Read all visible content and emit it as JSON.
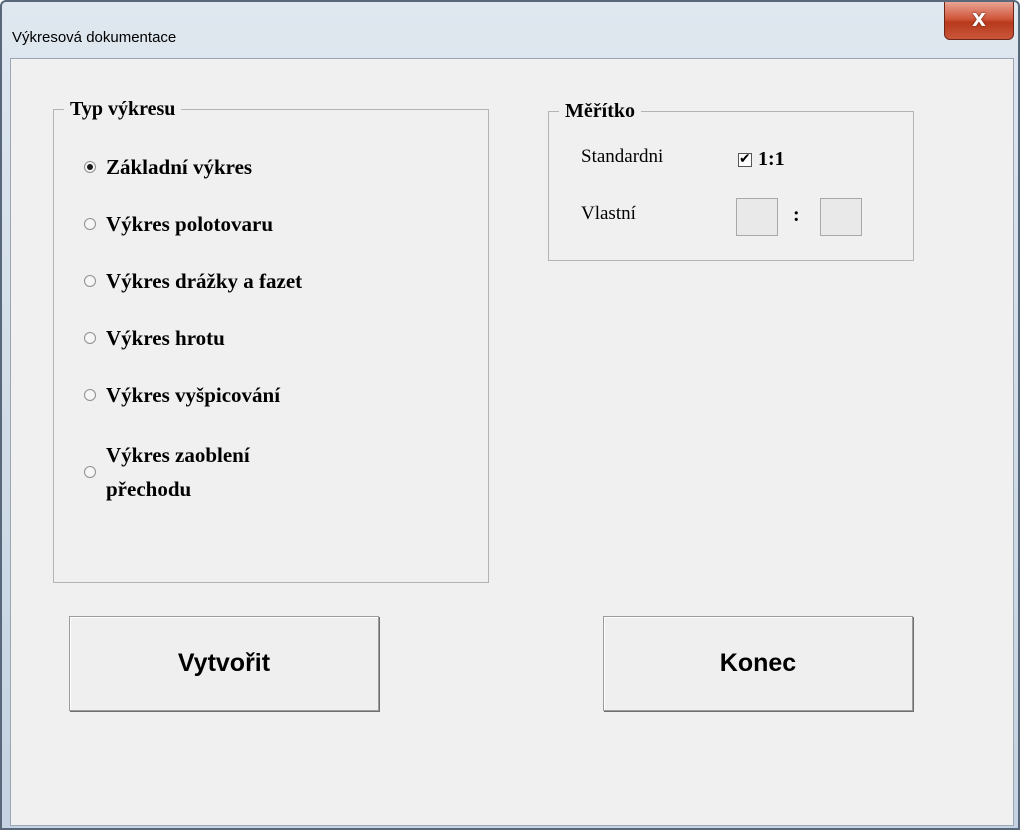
{
  "window": {
    "title": "Výkresová dokumentace",
    "close_label": "X"
  },
  "drawing_type": {
    "title": "Typ výkresu",
    "options": [
      {
        "label": "Základní výkres",
        "checked": true
      },
      {
        "label": "Výkres polotovaru",
        "checked": false
      },
      {
        "label": "Výkres drážky a fazet",
        "checked": false
      },
      {
        "label": "Výkres hrotu",
        "checked": false
      },
      {
        "label": "Výkres vyšpicování",
        "checked": false
      },
      {
        "label": "Výkres zaoblení\npřechodu",
        "checked": false
      }
    ]
  },
  "scale": {
    "title": "Měřítko",
    "standard_label": "Standardni",
    "standard_checked": true,
    "standard_value": "1:1",
    "custom_label": "Vlastní",
    "custom_numerator": "",
    "custom_denominator": "",
    "colon": ":"
  },
  "buttons": {
    "create_label": "Vytvořit",
    "end_label": "Konec"
  }
}
